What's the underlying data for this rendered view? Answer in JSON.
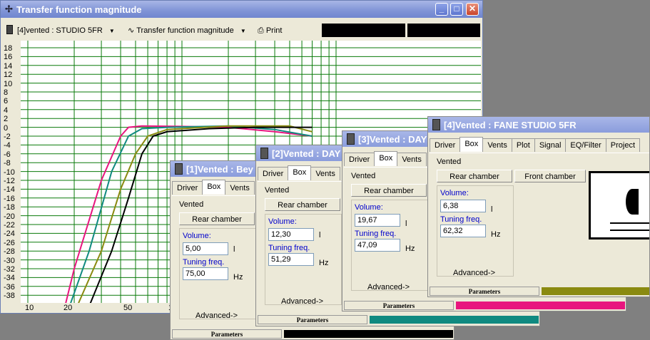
{
  "main": {
    "title": "Transfer function magnitude",
    "toolbar": {
      "driver_select": "[4]vented : STUDIO 5FR",
      "view_select": "Transfer function magnitude",
      "print_label": "Print"
    },
    "y_ticks": [
      "18",
      "16",
      "14",
      "12",
      "10",
      "8",
      "6",
      "4",
      "2",
      "0",
      "-2",
      "-4",
      "-6",
      "-8",
      "-10",
      "-12",
      "-14",
      "-16",
      "-18",
      "-20",
      "-22",
      "-24",
      "-26",
      "-28",
      "-30",
      "-32",
      "-34",
      "-36",
      "-38"
    ],
    "x_ticks": [
      "10",
      "20",
      "50",
      "1"
    ]
  },
  "windows": [
    {
      "title": "[1]Vented : Bey",
      "tabs": [
        "Driver",
        "Box",
        "Vents"
      ],
      "section": "Vented",
      "chamber_btn": "Rear chamber",
      "volume_label": "Volume:",
      "volume_value": "5,00",
      "volume_unit": "l",
      "tuning_label": "Tuning freq.",
      "tuning_value": "75,00",
      "tuning_unit": "Hz",
      "advanced": "Advanced->",
      "status_label": "Parameters",
      "color": "#000000"
    },
    {
      "title": "[2]Vented : DAY",
      "tabs": [
        "Driver",
        "Box",
        "Vents"
      ],
      "section": "Vented",
      "chamber_btn": "Rear chamber",
      "volume_label": "Volume:",
      "volume_value": "12,30",
      "volume_unit": "l",
      "tuning_label": "Tuning freq.",
      "tuning_value": "51,29",
      "tuning_unit": "Hz",
      "advanced": "Advanced->",
      "status_label": "Parameters",
      "color": "#108a80"
    },
    {
      "title": "[3]Vented : DAY",
      "tabs": [
        "Driver",
        "Box",
        "Vents"
      ],
      "section": "Vented",
      "chamber_btn": "Rear chamber",
      "volume_label": "Volume:",
      "volume_value": "19,67",
      "volume_unit": "l",
      "tuning_label": "Tuning freq.",
      "tuning_value": "47,09",
      "tuning_unit": "Hz",
      "advanced": "Advanced->",
      "status_label": "Parameters",
      "color": "#e8157e"
    },
    {
      "title": "[4]Vented : FANE STUDIO 5FR",
      "tabs": [
        "Driver",
        "Box",
        "Vents",
        "Plot",
        "Signal",
        "EQ/Filter",
        "Project"
      ],
      "section": "Vented",
      "chamber_btn": "Rear chamber",
      "front_btn": "Front chamber",
      "volume_label": "Volume:",
      "volume_value": "6,38",
      "volume_unit": "l",
      "tuning_label": "Tuning freq.",
      "tuning_value": "62,32",
      "tuning_unit": "Hz",
      "advanced": "Advanced->",
      "status_label": "Parameters",
      "color": "#8a8a10"
    }
  ],
  "colors": {
    "grid": "#0a7a0a",
    "curve_black": "#000000",
    "curve_teal": "#108a80",
    "curve_pink": "#e8157e",
    "curve_olive": "#8a8a10"
  }
}
